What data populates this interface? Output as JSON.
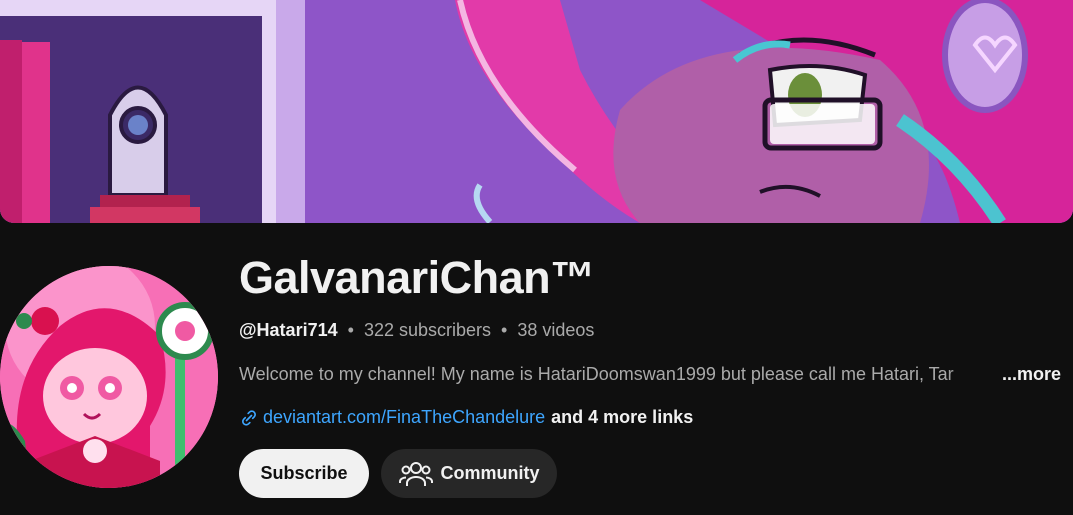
{
  "channel": {
    "name": "GalvanariChan™",
    "handle": "@Hatari714",
    "subscribers": "322 subscribers",
    "videos": "38 videos",
    "separator": "•",
    "description": "Welcome to my channel! My name is HatariDoomswan1999 but please call me Hatari, Tar",
    "more_label": "...more",
    "link_url": "deviantart.com/FinaTheChandelure",
    "more_links": "and 4 more links"
  },
  "actions": {
    "subscribe_label": "Subscribe",
    "community_label": "Community"
  },
  "icons": {
    "link": "link-icon",
    "community": "people-icon"
  },
  "colors": {
    "background": "#0f0f0f",
    "primary_text": "#f1f1f1",
    "secondary_text": "#aaaaaa",
    "link": "#3ea6ff",
    "subscribe_bg": "#f1f1f1",
    "community_bg": "#272727"
  }
}
